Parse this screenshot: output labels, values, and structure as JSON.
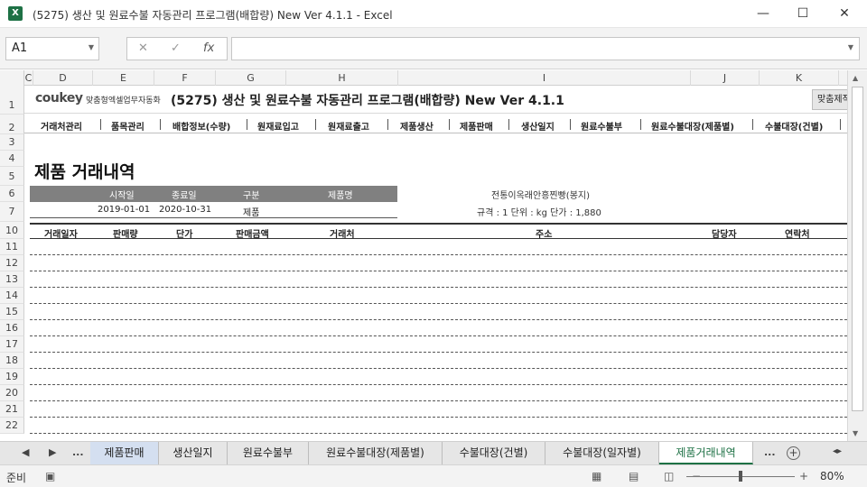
{
  "window": {
    "app_icon": "X",
    "title": "(5275) 생산 및 원료수불 자동관리 프로그램(배합량) New Ver 4.1.1  -  Excel",
    "minimize": "—",
    "maximize": "☐",
    "close": "✕"
  },
  "formula_bar": {
    "name_box": "A1",
    "cancel": "✕",
    "enter": "✓",
    "fx": "fx",
    "value": ""
  },
  "columns": [
    "C",
    "D",
    "E",
    "F",
    "G",
    "H",
    "I",
    "J",
    "K"
  ],
  "rows": [
    "1",
    "2",
    "3",
    "4",
    "5",
    "6",
    "7",
    "10",
    "11",
    "12",
    "13",
    "14",
    "15",
    "16",
    "17",
    "18",
    "19",
    "20",
    "21",
    "22"
  ],
  "banner": {
    "logo": "coukey",
    "logo_sub": "맞춤형엑셀업무자동화",
    "title": "(5275) 생산 및 원료수불 자동관리 프로그램(배합량) New Ver 4.1.1",
    "right_button": "맞춤제작"
  },
  "menu": [
    "거래처관리",
    "품목관리",
    "배합정보(수량)",
    "원재료입고",
    "원재료출고",
    "제품생산",
    "제품판매",
    "생산일지",
    "원료수불부",
    "원료수불대장(제품별)",
    "수불대장(건별)"
  ],
  "heading": "제품 거래내역",
  "filter": {
    "headers": [
      "시작일",
      "종료일",
      "구분",
      "제품명"
    ],
    "start_date": "2019-01-01",
    "end_date": "2020-10-31",
    "category": "제품",
    "product": ""
  },
  "product_info": {
    "name": "전통이옥래안흥찐빵(봉지)",
    "spec_line": "규격 : 1   단위 : kg   단가 : 1,880"
  },
  "table_headers": [
    "거래일자",
    "판매량",
    "단가",
    "판매금액",
    "거래처",
    "주소",
    "담당자",
    "연락처"
  ],
  "sheet_tabs": {
    "nav_prev": "◀",
    "nav_next": "▶",
    "more_left": "...",
    "tabs": [
      "제품판매",
      "생산일지",
      "원료수불부",
      "원료수불대장(제품별)",
      "수불대장(건별)",
      "수불대장(일자별)",
      "제품거래내역"
    ],
    "active": "제품거래내역",
    "more_right": "...",
    "add": "+"
  },
  "status_bar": {
    "ready": "준비",
    "zoom": "80%",
    "zoom_minus": "−",
    "zoom_plus": "+"
  }
}
